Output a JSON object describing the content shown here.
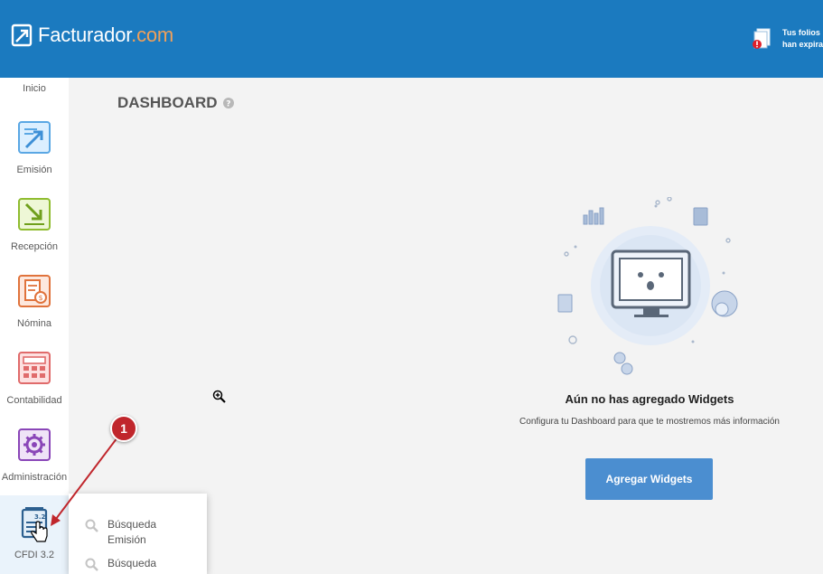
{
  "header": {
    "logo_main": "Facturador",
    "logo_suffix": ".com",
    "notification_line1": "Tus folios",
    "notification_line2": "han expira"
  },
  "sidebar": {
    "items": [
      {
        "label": "Inicio",
        "icon": "home-icon"
      },
      {
        "label": "Emisión",
        "icon": "document-send-icon"
      },
      {
        "label": "Recepción",
        "icon": "document-receive-icon"
      },
      {
        "label": "Nómina",
        "icon": "payroll-icon"
      },
      {
        "label": "Contabilidad",
        "icon": "calculator-icon"
      },
      {
        "label": "Administración",
        "icon": "gear-icon"
      },
      {
        "label": "CFDI 3.2",
        "icon": "cfdi-document-icon",
        "active": true
      }
    ]
  },
  "main": {
    "title": "DASHBOARD",
    "empty_title": "Aún no has agregado Widgets",
    "empty_subtitle": "Configura tu Dashboard para que te mostremos más información",
    "add_button": "Agregar Widgets"
  },
  "submenu": {
    "items": [
      {
        "label": "Búsqueda Emisión"
      },
      {
        "label": "Búsqueda"
      }
    ]
  },
  "annotation": {
    "badge": "1"
  },
  "colors": {
    "header_bg": "#1b7abf",
    "primary_button": "#4b8ed0",
    "annotation_red": "#c0262c",
    "logo_accent": "#f0a05a"
  }
}
